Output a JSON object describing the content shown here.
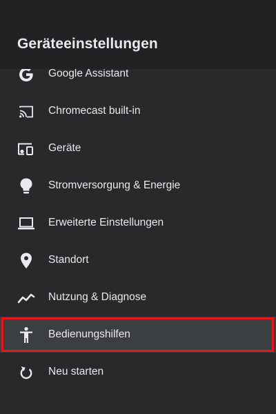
{
  "header": {
    "title": "Geräteeinstellungen"
  },
  "menu": {
    "items": [
      {
        "label": "Google Assistant",
        "icon": "google-g-icon"
      },
      {
        "label": "Chromecast built-in",
        "icon": "cast-icon"
      },
      {
        "label": "Geräte",
        "icon": "devices-icon"
      },
      {
        "label": "Stromversorgung & Energie",
        "icon": "lightbulb-icon"
      },
      {
        "label": "Erweiterte Einstellungen",
        "icon": "laptop-icon"
      },
      {
        "label": "Standort",
        "icon": "location-pin-icon"
      },
      {
        "label": "Nutzung & Diagnose",
        "icon": "trending-line-icon"
      },
      {
        "label": "Bedienungshilfen",
        "icon": "accessibility-icon"
      },
      {
        "label": "Neu starten",
        "icon": "restart-icon"
      }
    ],
    "focused_item": "Bedienungshilfen"
  },
  "colors": {
    "background": "#27292a",
    "header_background": "#202223",
    "focused_background": "#3c3f41",
    "highlight_border": "#e8151c",
    "text": "#e8eaed"
  }
}
